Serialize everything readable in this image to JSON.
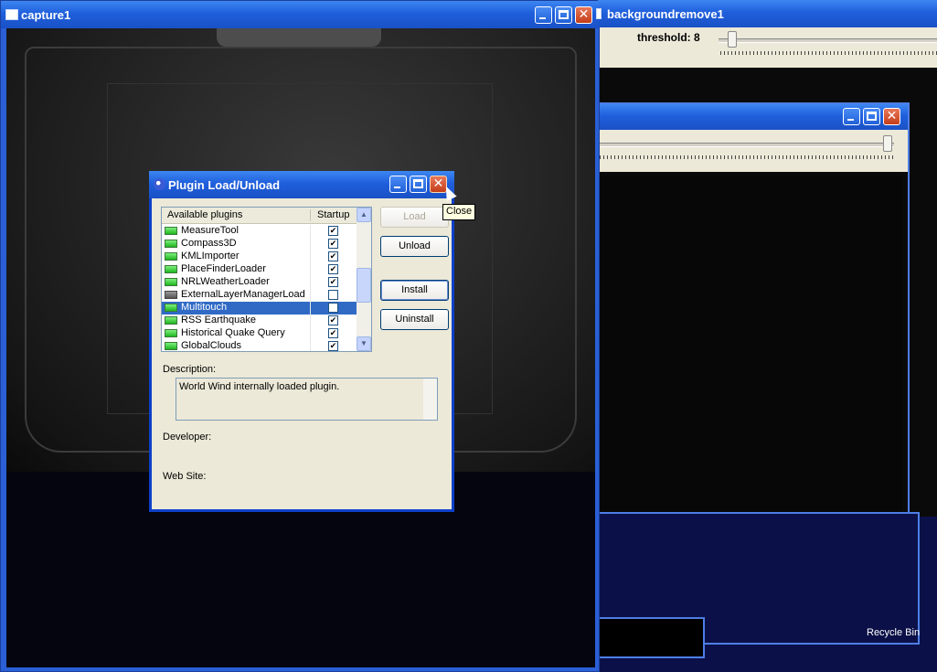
{
  "capture_window": {
    "title": "capture1"
  },
  "bg_window": {
    "title": "backgroundremove1",
    "threshold_label": "threshold: 8"
  },
  "desktop": {
    "recycle_bin": "Recycle Bin"
  },
  "dialog": {
    "title": "Plugin Load/Unload",
    "columns": {
      "name": "Available plugins",
      "startup": "Startup"
    },
    "plugins": [
      {
        "name": "MeasureTool",
        "startup": "✔",
        "icon": "green"
      },
      {
        "name": "Compass3D",
        "startup": "✔",
        "icon": "green"
      },
      {
        "name": "KMLImporter",
        "startup": "✔",
        "icon": "green"
      },
      {
        "name": "PlaceFinderLoader",
        "startup": "✔",
        "icon": "green"
      },
      {
        "name": "NRLWeatherLoader",
        "startup": "✔",
        "icon": "green"
      },
      {
        "name": "ExternalLayerManagerLoad",
        "startup": "",
        "icon": "gray"
      },
      {
        "name": "Multitouch",
        "startup": "",
        "icon": "green",
        "selected": true
      },
      {
        "name": "RSS Earthquake",
        "startup": "✔",
        "icon": "green"
      },
      {
        "name": "Historical Quake Query",
        "startup": "✔",
        "icon": "green"
      },
      {
        "name": "GlobalClouds",
        "startup": "✔",
        "icon": "green"
      }
    ],
    "buttons": {
      "load": "Load",
      "unload": "Unload",
      "install": "Install",
      "uninstall": "Uninstall"
    },
    "description_label": "Description:",
    "description_text": "World Wind internally loaded plugin.",
    "developer_label": "Developer:",
    "website_label": "Web Site:",
    "close_tooltip": "Close"
  },
  "colors": {
    "titlebar": "#1f5fdc",
    "selection": "#316ac5",
    "dialog_bg": "#ece9d8"
  }
}
